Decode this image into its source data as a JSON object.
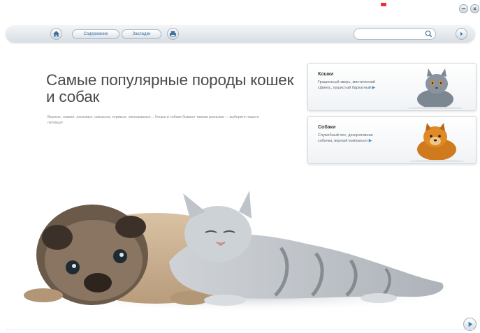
{
  "toolbar": {
    "contents_label": "Содержание",
    "bookmarks_label": "Закладки",
    "search_placeholder": ""
  },
  "main": {
    "title": "Самые популярные породы кошек и собак",
    "subtitle": "Верные, ловкие, ласковые, смешные, игривые, своенравные… Кошки и собаки бывают такими разными — выберите нашего питомца!"
  },
  "cards": [
    {
      "title": "Кошки",
      "desc": "Грациозный зверь, мистический сфинкс, пушистый бархатный",
      "icon": "cat-photo"
    },
    {
      "title": "Собаки",
      "desc": "Служебный пес, декоративная собачка, верный компаньон",
      "icon": "dog-photo"
    }
  ],
  "icons": {
    "home": "home-icon",
    "print": "print-icon",
    "search": "search-icon",
    "nav": "chevron-right-icon",
    "next": "play-right-icon"
  },
  "colors": {
    "accent": "#3f6f9a",
    "arrow": "#2f8fd6",
    "red_mark": "#e8332a"
  }
}
